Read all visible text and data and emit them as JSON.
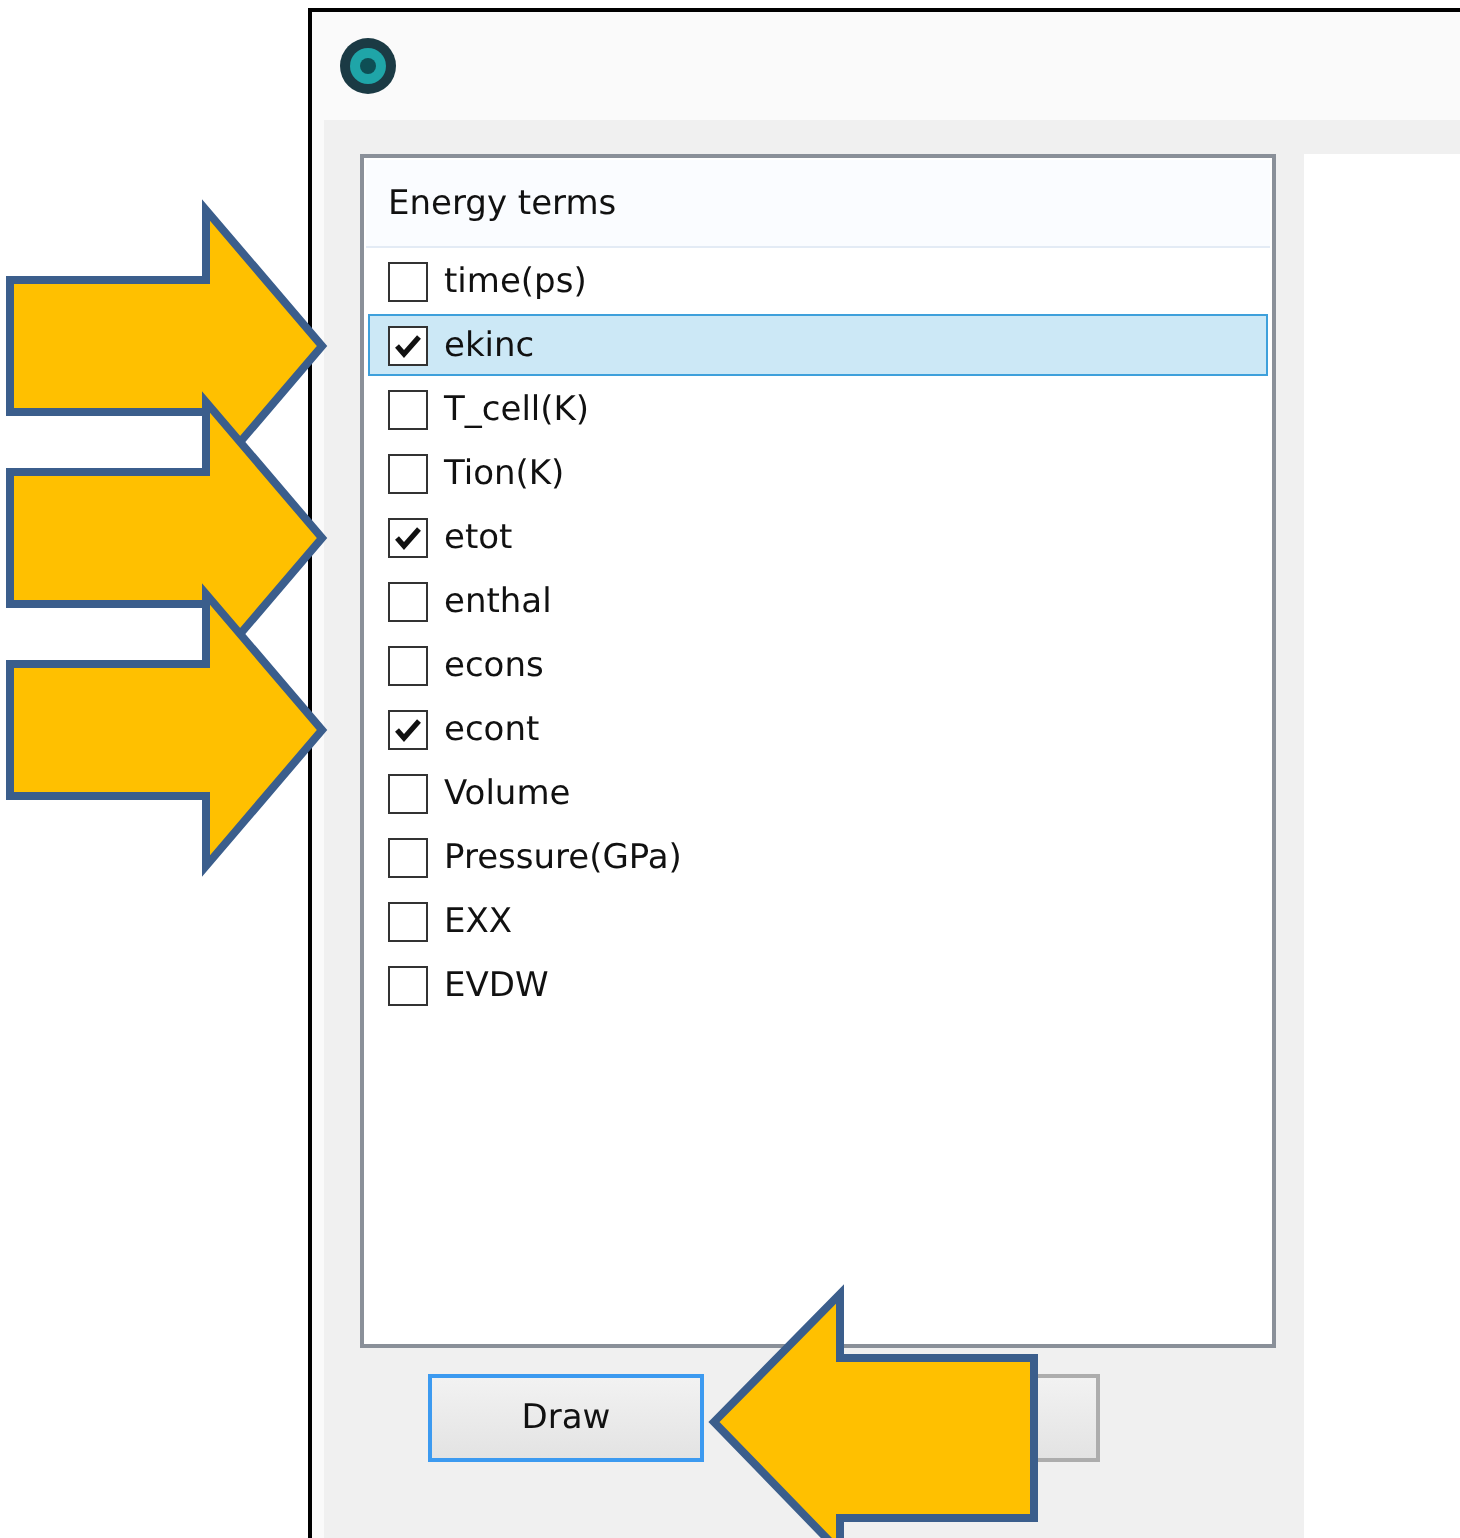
{
  "list": {
    "header": "Energy terms",
    "items": [
      {
        "label": "time(ps)",
        "checked": false,
        "selected": false,
        "pointed": false
      },
      {
        "label": "ekinc",
        "checked": true,
        "selected": true,
        "pointed": true
      },
      {
        "label": "T_cell(K)",
        "checked": false,
        "selected": false,
        "pointed": false
      },
      {
        "label": "Tion(K)",
        "checked": false,
        "selected": false,
        "pointed": false
      },
      {
        "label": "etot",
        "checked": true,
        "selected": false,
        "pointed": true
      },
      {
        "label": "enthal",
        "checked": false,
        "selected": false,
        "pointed": false
      },
      {
        "label": "econs",
        "checked": false,
        "selected": false,
        "pointed": false
      },
      {
        "label": "econt",
        "checked": true,
        "selected": false,
        "pointed": true
      },
      {
        "label": "Volume",
        "checked": false,
        "selected": false,
        "pointed": false
      },
      {
        "label": "Pressure(GPa)",
        "checked": false,
        "selected": false,
        "pointed": false
      },
      {
        "label": "EXX",
        "checked": false,
        "selected": false,
        "pointed": false
      },
      {
        "label": "EVDW",
        "checked": false,
        "selected": false,
        "pointed": false
      }
    ]
  },
  "buttons": [
    {
      "label": "Draw",
      "focused": true,
      "pointed": true
    }
  ]
}
